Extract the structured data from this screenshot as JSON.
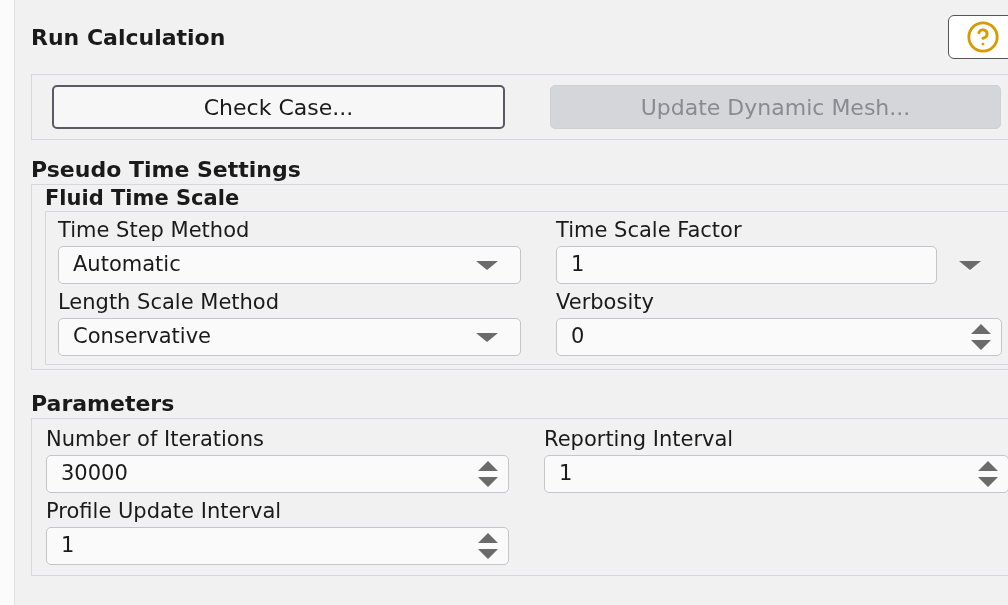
{
  "title": "Run Calculation",
  "buttons": [
    {
      "label": "Check Case...",
      "disabled": false
    },
    {
      "label": "Update Dynamic Mesh...",
      "disabled": true
    }
  ],
  "pseudo_time_settings": {
    "heading": "Pseudo Time Settings",
    "fluid_time_scale": {
      "heading": "Fluid Time Scale",
      "fields": [
        {
          "label": "Time Step Method",
          "value": "Automatic",
          "kind": "dropdown"
        },
        {
          "label": "Time Scale Factor",
          "value": "1",
          "kind": "input_with_menu"
        },
        {
          "label": "Length Scale Method",
          "value": "Conservative",
          "kind": "dropdown"
        },
        {
          "label": "Verbosity",
          "value": "0",
          "kind": "spinner"
        }
      ]
    }
  },
  "parameters": {
    "heading": "Parameters",
    "fields": [
      {
        "label": "Number of Iterations",
        "value": "30000",
        "kind": "spinner"
      },
      {
        "label": "Reporting Interval",
        "value": "1",
        "kind": "spinner"
      },
      {
        "label": "Profile Update Interval",
        "value": "1",
        "kind": "spinner"
      }
    ]
  }
}
